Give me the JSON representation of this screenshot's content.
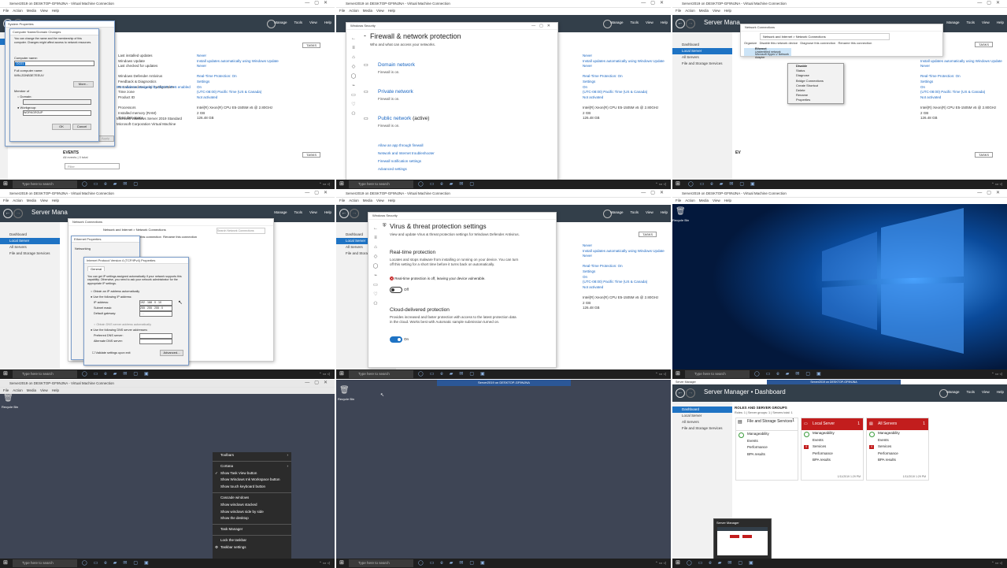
{
  "vm": {
    "title": "Server2019 on DESKTOP-GF9NJNA - Virtual Machine Connection",
    "menu": [
      "File",
      "Action",
      "Media",
      "View",
      "Help"
    ]
  },
  "server_manager": {
    "title_short": "Server Mana",
    "title_dashboard": "Server Manager • Dashboard",
    "menus": [
      "Manage",
      "Tools",
      "View",
      "Help"
    ],
    "sidebar": [
      "Dashboard",
      "Local Server",
      "All Servers",
      "File and Storage Services"
    ],
    "tasks": "TASKS",
    "events": "EVENTS",
    "events_sub": "All events | 0 total",
    "filter": "Filter"
  },
  "taskbar": {
    "search_placeholder": "Type here to search"
  },
  "panel1": {
    "dialog_title": "System Properties",
    "inner_title": "Computer Name/Domain Changes",
    "inner_desc": "You can change the name and the membership of this computer. Changes might affect access to network resources.",
    "computer_name_label": "Computer name:",
    "computer_name_value": "DC01",
    "full_name_label": "Full computer name:",
    "full_name_value": "WIN-2DNB3E7EEUV",
    "more_btn": "More...",
    "member_of": "Member of",
    "domain": "Domain:",
    "workgroup": "Workgroup:",
    "workgroup_value": "WORKGROUP",
    "ok": "OK",
    "cancel": "Cancel",
    "apply": "Apply",
    "props_left": [
      "Last installed updates",
      "Windows Update",
      "Last checked for updates",
      "",
      "Windows Defender Antivirus",
      "Feedback & Diagnostics",
      "IE Enhanced Security Configuration",
      "Time zone",
      "Product ID",
      "",
      "Processors",
      "Installed memory (RAM)",
      "Total disk space"
    ],
    "props_right": [
      "Never",
      "Install updates automatically using Windows Update",
      "Never",
      "",
      "Real-Time Protection: On",
      "Settings",
      "On",
      "(UTC-08:00) Pacific Time (US & Canada)",
      "Not activated",
      "",
      "Intel(R) Xeon(R) CPU E5-1505M v5 @ 2.80GHz",
      "2 GB",
      "126.48 GB"
    ],
    "props_mid": [
      "",
      "",
      "",
      "",
      "",
      "",
      "IPv4 address assigned by DHCP, IPv6 enabled",
      "",
      "",
      "",
      "Microsoft Windows Server 2019 Standard",
      "Microsoft Corporation Virtual Machine"
    ]
  },
  "panel2": {
    "window_title": "Windows Security",
    "heading": "Firewall & network protection",
    "subheading": "Who and what can access your networks.",
    "networks": [
      {
        "name": "Domain network",
        "status": "Firewall is on."
      },
      {
        "name": "Private network",
        "status": "Firewall is on."
      },
      {
        "name": "Public network",
        "active": "(active)",
        "status": "Firewall is on."
      }
    ],
    "links": [
      "Allow an app through firewall",
      "Network and Internet troubleshooter",
      "Firewall notification settings",
      "Advanced settings"
    ]
  },
  "panel3": {
    "window_title": "Network Connections",
    "address": "Network and Internet > Network Connections",
    "toolbar": [
      "Organize",
      "Disable this network device",
      "Diagnose this connection",
      "Rename this connection"
    ],
    "adapter_name": "Ethernet",
    "adapter_status": "Unidentified network",
    "adapter_driver": "Microsoft Hyper-V Network Adapter",
    "context_menu": [
      "Disable",
      "Status",
      "Diagnose",
      "Bridge Connections",
      "Create Shortcut",
      "Delete",
      "Rename",
      "Properties"
    ]
  },
  "panel4": {
    "dialog_title": "Internet Protocol Version 4 (TCP/IPv4) Properties",
    "tab": "General",
    "networking_tab": "Networking",
    "desc": "You can get IP settings assigned automatically if your network supports this capability. Otherwise, you need to ask your network administrator for the appropriate IP settings.",
    "obtain_auto": "Obtain an IP address automatically",
    "use_following": "Use the following IP address:",
    "ip_label": "IP address:",
    "ip_value": "192 . 168 . 0 . 10",
    "subnet_label": "Subnet mask:",
    "subnet_value": "255 . 255 . 255 . 0",
    "gateway_label": "Default gateway:",
    "gateway_value": ". . .",
    "obtain_dns": "Obtain DNS server address automatically",
    "use_dns": "Use the following DNS server addresses:",
    "preferred_dns": "Preferred DNS server:",
    "alternate_dns": "Alternate DNS server:",
    "validate": "Validate settings upon exit",
    "advanced": "Advanced...",
    "search": "Search Network Connections"
  },
  "panel5": {
    "window_title": "Windows Security",
    "heading": "Virus & threat protection settings",
    "subheading": "View and update Virus & threat protection settings for Windows Defender Antivirus.",
    "rt_heading": "Real-time protection",
    "rt_desc": "Locates and stops malware from installing or running on your device. You can turn off this setting for a short time before it turns back on automatically.",
    "rt_warning": "Real-time protection is off, leaving your device vulnerable.",
    "rt_toggle": "Off",
    "cloud_heading": "Cloud-delivered protection",
    "cloud_desc": "Provides increased and faster protection with access to the latest protection data in the cloud. Works best with Automatic sample submission turned on.",
    "cloud_toggle": "On"
  },
  "panel6": {
    "recycle_bin": "Recycle Bin"
  },
  "panel7": {
    "recycle_bin": "Recycle Bin",
    "context_menu": [
      "Toolbars",
      "Cortana",
      "Show Task View button",
      "Show Windows Ink Workspace button",
      "Show touch keyboard button",
      "Cascade windows",
      "Show windows stacked",
      "Show windows side by side",
      "Show the desktop",
      "Task Manager",
      "Lock the taskbar",
      "Taskbar settings"
    ]
  },
  "panel8": {
    "recycle_bin": "Recycle Bin",
    "banner": "Server2019 on DESKTOP-GF9NJNA"
  },
  "panel9": {
    "header": "ROLES AND SERVER GROUPS",
    "subheader": "Roles: 1 | Server groups: 1 | Servers total: 1",
    "tiles": [
      {
        "title": "File and Storage Services",
        "count": "1",
        "rows": [
          "Manageability",
          "Events",
          "Performance",
          "BPA results"
        ],
        "timestamp": ""
      },
      {
        "title": "Local Server",
        "count": "1",
        "rows": [
          "Manageability",
          "Events",
          "Services",
          "Performance",
          "BPA results"
        ],
        "timestamp": "1/11/2019 1:29 PM"
      },
      {
        "title": "All Servers",
        "count": "1",
        "rows": [
          "Manageability",
          "Events",
          "Services",
          "Performance",
          "BPA results"
        ],
        "timestamp": "1/11/2019 1:29 PM"
      }
    ],
    "thumbnail_title": "Server Manager"
  },
  "colors": {
    "sm_header": "#333f4a",
    "accent_blue": "#1e73c4",
    "tile_red": "#c21d1d",
    "desktop_dark": "#3e4555",
    "win10_blue": "#0a4a9a"
  }
}
